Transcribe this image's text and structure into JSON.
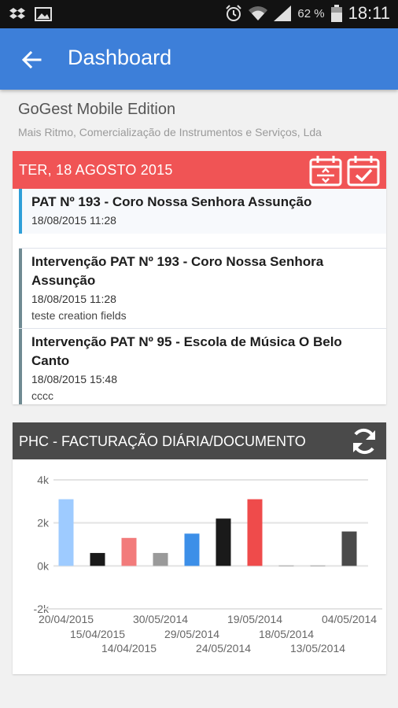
{
  "status_bar": {
    "left_icons": [
      "dropbox-icon",
      "image-icon"
    ],
    "right_icons": [
      "alarm-icon",
      "wifi-icon",
      "signal-icon",
      "battery-icon"
    ],
    "battery_percent": "62 %",
    "time": "18:11"
  },
  "app_bar": {
    "title": "Dashboard",
    "back_icon": "arrow-back-icon"
  },
  "company": {
    "name": "GoGest Mobile Edition",
    "subtitle": "Mais Ritmo, Comercialização de Instrumentos e Serviços, Lda"
  },
  "agenda": {
    "date": "TER, 18 AGOSTO 2015",
    "header_color": "#f05455",
    "buttons": [
      "calendar-icon",
      "calendar-check-icon"
    ],
    "events": [
      {
        "title": "PAT Nº 193 - Coro Nossa Senhora Assunção",
        "time": "18/08/2015 11:28",
        "desc": ""
      },
      {
        "title": "Intervenção PAT Nº 193 - Coro Nossa Senhora Assunção",
        "time": "18/08/2015 11:28",
        "desc": "teste creation fields"
      },
      {
        "title": "Intervenção PAT Nº 95 - Escola de Música O Belo Canto",
        "time": "18/08/2015 15:48",
        "desc": "cccc"
      }
    ]
  },
  "chart_card": {
    "title": "PHC - FACTURAÇÃO DIÁRIA/DOCUMENTO",
    "refresh_icon": "refresh-icon",
    "header_color": "#4a4a4a"
  },
  "chart_data": {
    "type": "bar",
    "ylim": [
      -2000,
      4000
    ],
    "yticks": [
      "4k",
      "2k",
      "0k",
      "-2k"
    ],
    "ytick_values": [
      4000,
      2000,
      0,
      -2000
    ],
    "grid": true,
    "categories": [
      "20/04/2015",
      "15/04/2015",
      "14/04/2015",
      "30/05/2014",
      "29/05/2014",
      "24/05/2014",
      "19/05/2014",
      "18/05/2014",
      "13/05/2014",
      "04/05/2014"
    ],
    "values": [
      3100,
      600,
      1300,
      600,
      1500,
      2200,
      3100,
      0,
      0,
      1600
    ],
    "colors": [
      "#9ecbff",
      "#1a1a1a",
      "#f27b7b",
      "#9a9a9a",
      "#3c8fe8",
      "#1a1a1a",
      "#ef4b4b",
      "#bdbdbd",
      "#bdbdbd",
      "#4a4a4a"
    ],
    "label_rows": [
      0,
      1,
      2,
      0,
      1,
      2,
      0,
      1,
      2,
      0
    ]
  }
}
